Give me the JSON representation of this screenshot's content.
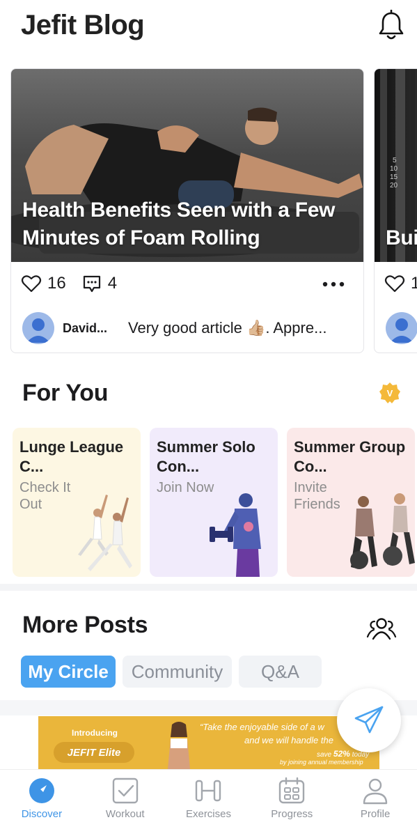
{
  "header": {
    "title": "Jefit Blog",
    "bell_icon": "bell-icon"
  },
  "blog_cards": [
    {
      "title": "Health Benefits Seen with a Few Minutes of Foam Rolling",
      "likes": "16",
      "comments": "4",
      "comment_author": "David...",
      "comment_text": "Very good article 👍🏼. Appre..."
    },
    {
      "title": "Bui",
      "likes": "1"
    }
  ],
  "for_you": {
    "title": "For You",
    "badge_letter": "V",
    "badge_color": "#f4b93a",
    "cards": [
      {
        "title": "Lunge League C...",
        "subtitle": "Check It Out",
        "bg": "#fdf7e3"
      },
      {
        "title": "Summer Solo Con...",
        "subtitle": "Join Now",
        "bg": "#f1ebfb"
      },
      {
        "title": "Summer Group Co...",
        "subtitle": "Invite Friends",
        "bg": "#fbe9e9"
      }
    ]
  },
  "more_posts": {
    "title": "More Posts",
    "tabs": [
      {
        "label": "My Circle",
        "active": true
      },
      {
        "label": "Community",
        "active": false
      },
      {
        "label": "Q&A",
        "active": false
      }
    ]
  },
  "banner": {
    "intro": "Introducing",
    "product": "JEFIT Elite",
    "quote_line1": "“Take the enjoyable side of a w",
    "quote_line2": "and we will handle the",
    "save_prefix": "save",
    "save_percent": "52%",
    "save_suffix": "today",
    "annual": "by joining annual membership"
  },
  "bottom_nav": [
    {
      "label": "Discover",
      "icon": "compass-icon",
      "active": true
    },
    {
      "label": "Workout",
      "icon": "checkbox-icon",
      "active": false
    },
    {
      "label": "Exercises",
      "icon": "dumbbell-icon",
      "active": false
    },
    {
      "label": "Progress",
      "icon": "calendar-icon",
      "active": false
    },
    {
      "label": "Profile",
      "icon": "person-icon",
      "active": false
    }
  ],
  "colors": {
    "accent": "#4aa3f0",
    "nav_active": "#3e94e6",
    "banner": "#eab63b"
  }
}
